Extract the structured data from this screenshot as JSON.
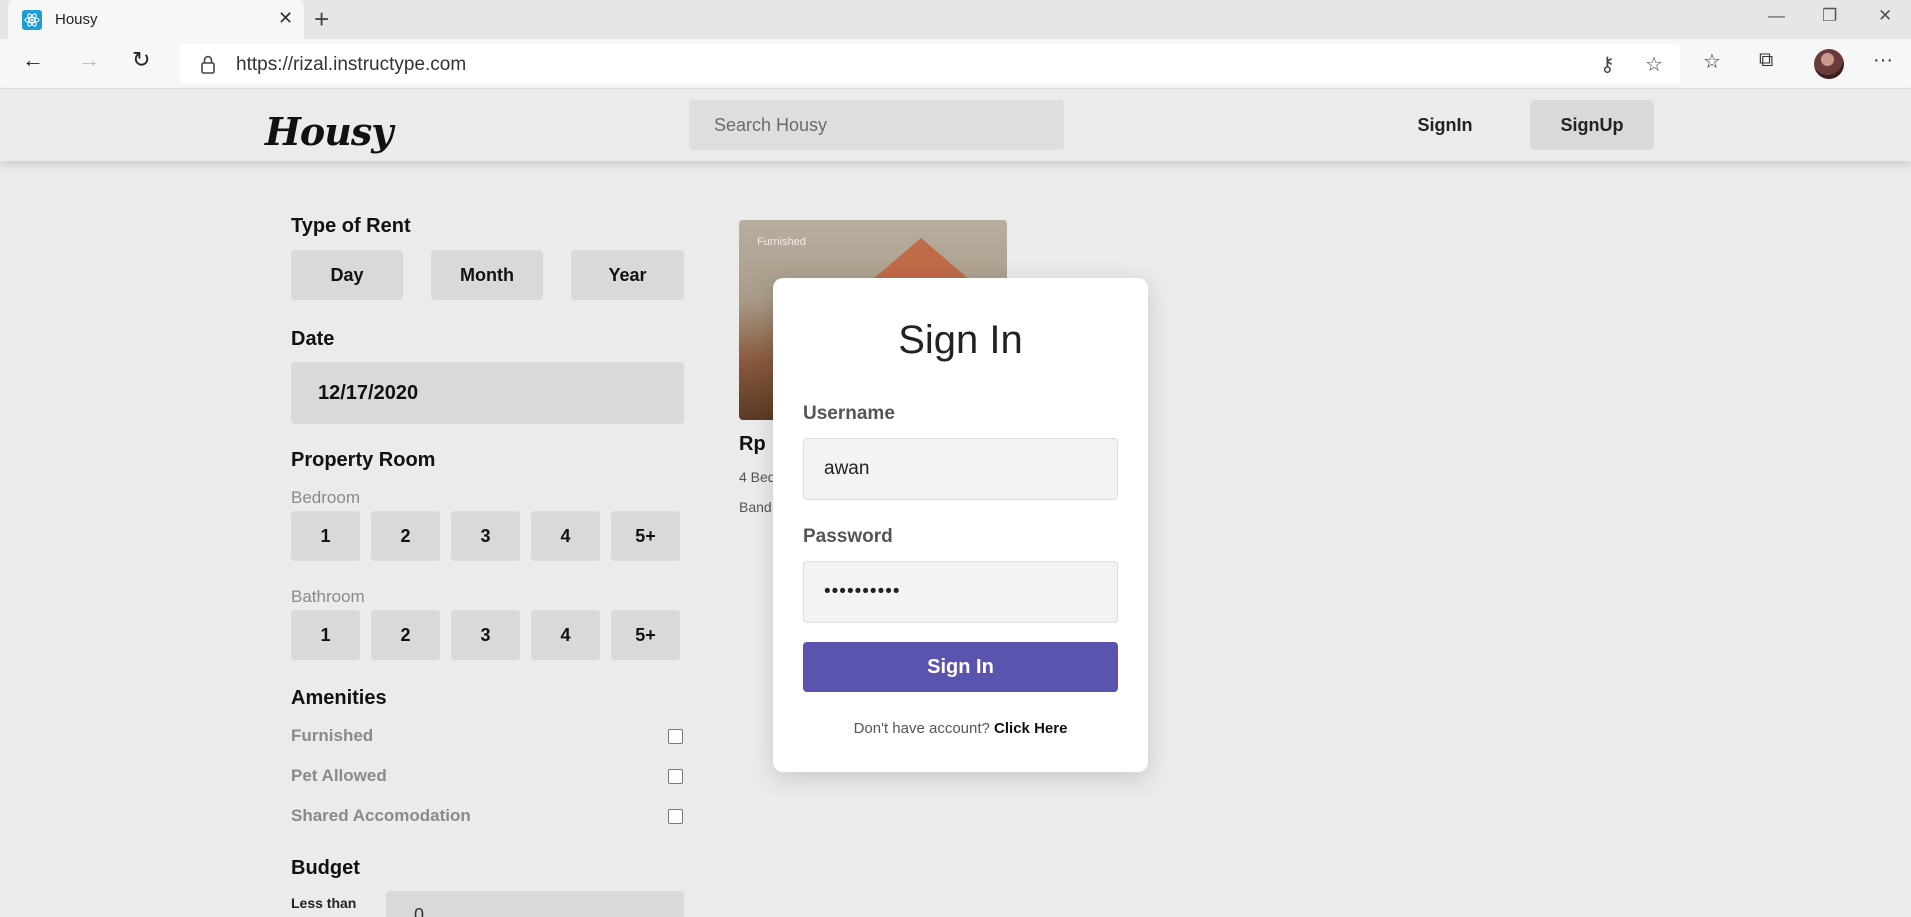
{
  "browser": {
    "tab_title": "Housy",
    "url": "https://rizal.instructype.com"
  },
  "header": {
    "logo_text": "Housy",
    "search_placeholder": "Search Housy",
    "signin_label": "SignIn",
    "signup_label": "SignUp"
  },
  "filters": {
    "type_of_rent": {
      "title": "Type of Rent",
      "options": [
        "Day",
        "Month",
        "Year"
      ]
    },
    "date": {
      "title": "Date",
      "value": "12/17/2020"
    },
    "property_room": {
      "title": "Property Room",
      "bedroom_label": "Bedroom",
      "bedroom_options": [
        "1",
        "2",
        "3",
        "4",
        "5+"
      ],
      "bathroom_label": "Bathroom",
      "bathroom_options": [
        "1",
        "2",
        "3",
        "4",
        "5+"
      ]
    },
    "amenities": {
      "title": "Amenities",
      "items": [
        "Furnished",
        "Pet Allowed",
        "Shared Accomodation"
      ]
    },
    "budget": {
      "title": "Budget",
      "less_than_label": "Less than",
      "value": "0"
    }
  },
  "card": {
    "badge": "Furnished",
    "price_partial": "Rp",
    "meta_line1_partial": "4 Bed",
    "meta_line2_partial": "Band"
  },
  "modal": {
    "title": "Sign In",
    "username_label": "Username",
    "username_value": "awan",
    "password_label": "Password",
    "password_value": "••••••••••",
    "submit_label": "Sign In",
    "footer_text": "Don't have account?",
    "footer_link": "Click Here"
  },
  "colors": {
    "primary_button": "#5a54ae",
    "page_bg": "#ebebeb",
    "pill_bg": "#d9d9d9"
  }
}
